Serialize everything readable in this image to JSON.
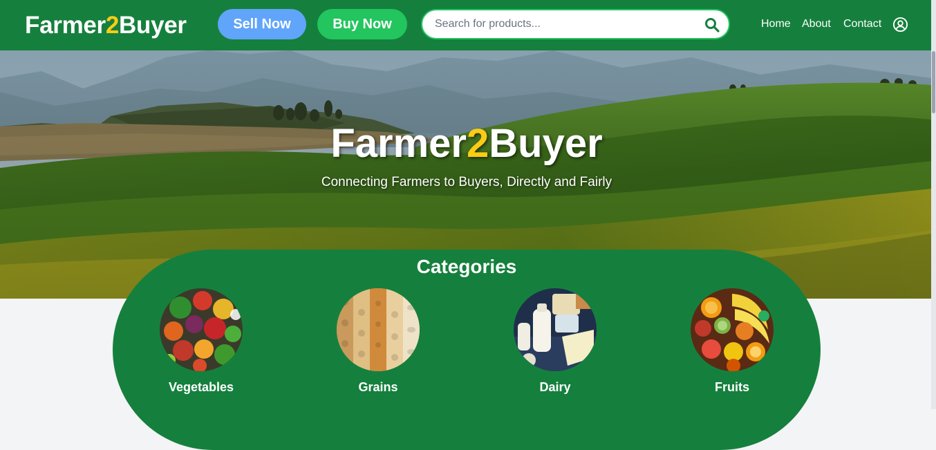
{
  "header": {
    "logo": {
      "part1": "Farmer",
      "part2": "2",
      "part3": "Buyer"
    },
    "sell_button": "Sell Now",
    "buy_button": "Buy Now",
    "search": {
      "placeholder": "Search for products...",
      "value": "",
      "icon": "search-icon"
    },
    "nav": [
      "Home",
      "About",
      "Contact"
    ],
    "user_icon": "user-circle-icon"
  },
  "hero": {
    "title": {
      "part1": "Farmer",
      "part2": "2",
      "part3": "Buyer"
    },
    "subtitle": "Connecting Farmers to Buyers, Directly and Fairly"
  },
  "categories": {
    "title": "Categories",
    "items": [
      {
        "label": "Vegetables"
      },
      {
        "label": "Grains"
      },
      {
        "label": "Dairy"
      },
      {
        "label": "Fruits"
      }
    ]
  },
  "colors": {
    "brand_green": "#15803d",
    "accent_yellow": "#facc15",
    "sell_blue": "#60a5fa",
    "buy_green": "#22c55e",
    "page_background": "#f3f4f6"
  }
}
